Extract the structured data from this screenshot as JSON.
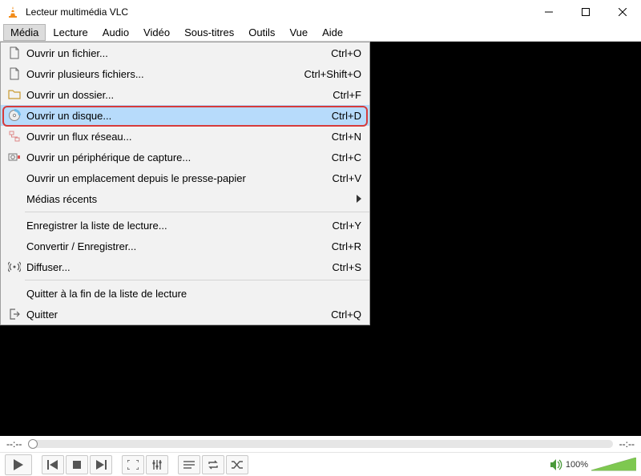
{
  "titlebar": {
    "title": "Lecteur multimédia VLC"
  },
  "menubar": {
    "items": [
      "Média",
      "Lecture",
      "Audio",
      "Vidéo",
      "Sous-titres",
      "Outils",
      "Vue",
      "Aide"
    ],
    "active_index": 0
  },
  "dropdown": {
    "items": [
      {
        "label": "Ouvrir un fichier...",
        "shortcut": "Ctrl+O",
        "icon": "file"
      },
      {
        "label": "Ouvrir plusieurs fichiers...",
        "shortcut": "Ctrl+Shift+O",
        "icon": "file"
      },
      {
        "label": "Ouvrir un dossier...",
        "shortcut": "Ctrl+F",
        "icon": "folder"
      },
      {
        "label": "Ouvrir un disque...",
        "shortcut": "Ctrl+D",
        "icon": "disc",
        "highlight": true
      },
      {
        "label": "Ouvrir un flux réseau...",
        "shortcut": "Ctrl+N",
        "icon": "network"
      },
      {
        "label": "Ouvrir un périphérique de capture...",
        "shortcut": "Ctrl+C",
        "icon": "capture"
      },
      {
        "label": "Ouvrir un emplacement depuis le presse-papier",
        "shortcut": "Ctrl+V",
        "icon": ""
      },
      {
        "label": "Médias récents",
        "shortcut": "",
        "icon": "",
        "submenu": true
      },
      {
        "sep": true
      },
      {
        "label": "Enregistrer la liste de lecture...",
        "shortcut": "Ctrl+Y",
        "icon": ""
      },
      {
        "label": "Convertir / Enregistrer...",
        "shortcut": "Ctrl+R",
        "icon": ""
      },
      {
        "label": "Diffuser...",
        "shortcut": "Ctrl+S",
        "icon": "stream"
      },
      {
        "sep": true
      },
      {
        "label": "Quitter à la fin de la liste de lecture",
        "shortcut": "",
        "icon": ""
      },
      {
        "label": "Quitter",
        "shortcut": "Ctrl+Q",
        "icon": "quit"
      }
    ]
  },
  "seekbar": {
    "time_left": "--:--",
    "time_right": "--:--"
  },
  "controls": {
    "volume_text": "100%"
  }
}
